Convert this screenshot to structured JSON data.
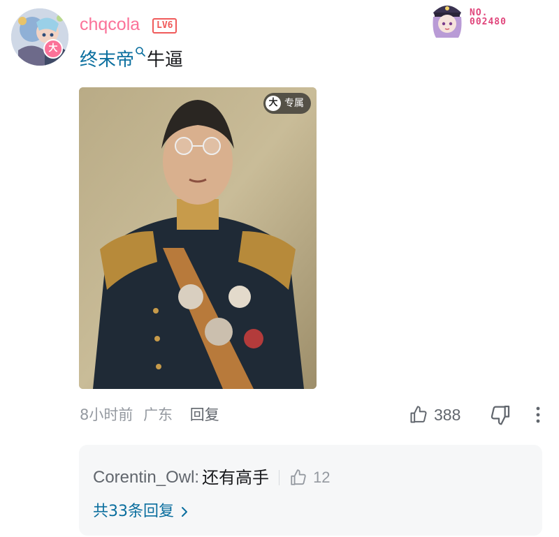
{
  "user": {
    "name": "chqcola",
    "level": "LV6",
    "avatar_badge": "大",
    "fan_number": "NO.\n002480"
  },
  "comment": {
    "link_text": "终末帝",
    "text": "牛逼",
    "exclusive_badge_icon": "大",
    "exclusive_label": "专属"
  },
  "meta": {
    "time": "8小时前",
    "location": "广东",
    "reply_label": "回复"
  },
  "actions": {
    "like_count": "388"
  },
  "reply_preview": {
    "author": "Corentin_Owl:",
    "content": "还有高手",
    "like_count": "12",
    "view_all": "共33条回复"
  },
  "colors": {
    "username": "#fb7299",
    "level_badge": "#f05a5a",
    "link": "#0a6e9e",
    "meta_text": "#9499a0",
    "reply_box_bg": "#f6f7f8"
  },
  "icons": {
    "like": "thumbs-up-icon",
    "dislike": "thumbs-down-icon",
    "more": "more-vertical-icon",
    "search": "search-icon",
    "chevron": "chevron-right-icon"
  }
}
